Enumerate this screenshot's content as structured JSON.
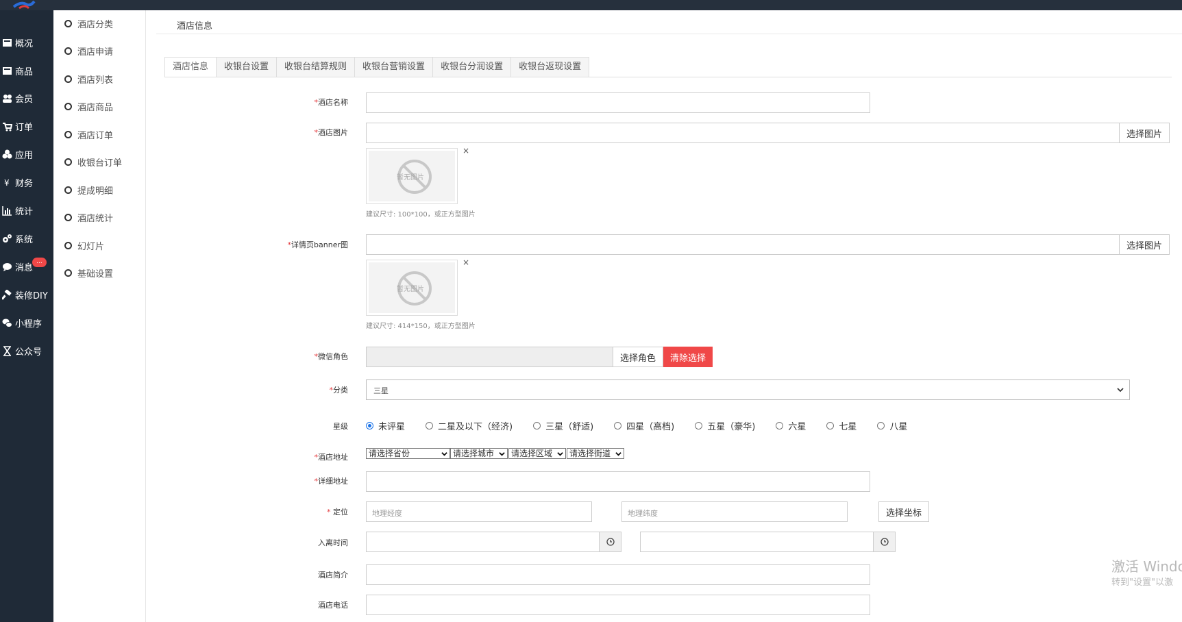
{
  "left_nav": {
    "items": [
      {
        "label": "概况",
        "icon": "dashboard-icon"
      },
      {
        "label": "商品",
        "icon": "goods-icon"
      },
      {
        "label": "会员",
        "icon": "members-icon"
      },
      {
        "label": "订单",
        "icon": "cart-icon"
      },
      {
        "label": "应用",
        "icon": "apps-icon"
      },
      {
        "label": "财务",
        "icon": "yen-icon"
      },
      {
        "label": "统计",
        "icon": "bar-chart-icon"
      },
      {
        "label": "系统",
        "icon": "gears-icon"
      },
      {
        "label": "消息",
        "icon": "chat-icon"
      },
      {
        "label": "装修DIY",
        "icon": "hammer-icon"
      },
      {
        "label": "小程序",
        "icon": "wechat-icon"
      },
      {
        "label": "公众号",
        "icon": "hourglass-icon"
      }
    ],
    "message_badge": "..."
  },
  "sub_nav": {
    "items": [
      "酒店分类",
      "酒店申请",
      "酒店列表",
      "酒店商品",
      "酒店订单",
      "收银台订单",
      "提成明细",
      "酒店统计",
      "幻灯片",
      "基础设置"
    ]
  },
  "page_title": "酒店信息",
  "tabs": [
    "酒店信息",
    "收银台设置",
    "收银台结算规则",
    "收银台营销设置",
    "收银台分润设置",
    "收银台返现设置"
  ],
  "form": {
    "required_mark": "*",
    "hotel_name_label": "酒店名称",
    "hotel_image_label": "酒店图片",
    "choose_image": "选择图片",
    "no_image_text": "暂无图片",
    "remove": "×",
    "hotel_image_hint": "建议尺寸: 100*100，或正方型图片",
    "banner_label": "详情页banner图",
    "banner_hint": "建议尺寸: 414*150，或正方型图片",
    "wechat_role_label": "微信角色",
    "choose_role": "选择角色",
    "clear_selection": "清除选择",
    "category_label": "分类",
    "category_value": "三星",
    "star_label": "星级",
    "star_options": [
      "未评星",
      "二星及以下（经济)",
      "三星（舒适)",
      "四星（高档)",
      "五星（豪华)",
      "六星",
      "七星",
      "八星"
    ],
    "star_selected": 0,
    "address_label": "酒店地址",
    "province_placeholder": "请选择省份",
    "city_placeholder": "请选择城市",
    "district_placeholder": "请选择区域",
    "street_placeholder": "请选择街道",
    "detail_address_label": "详细地址",
    "location_label": "定位",
    "longitude_placeholder": "地理经度",
    "latitude_placeholder": "地理纬度",
    "choose_coordinate": "选择坐标",
    "checkin_time_label": "入离时间",
    "intro_label": "酒店简介",
    "phone_label": "酒店电话"
  },
  "watermark": {
    "line1": "激活 Windo",
    "line2": "转到\"设置\"以激"
  }
}
